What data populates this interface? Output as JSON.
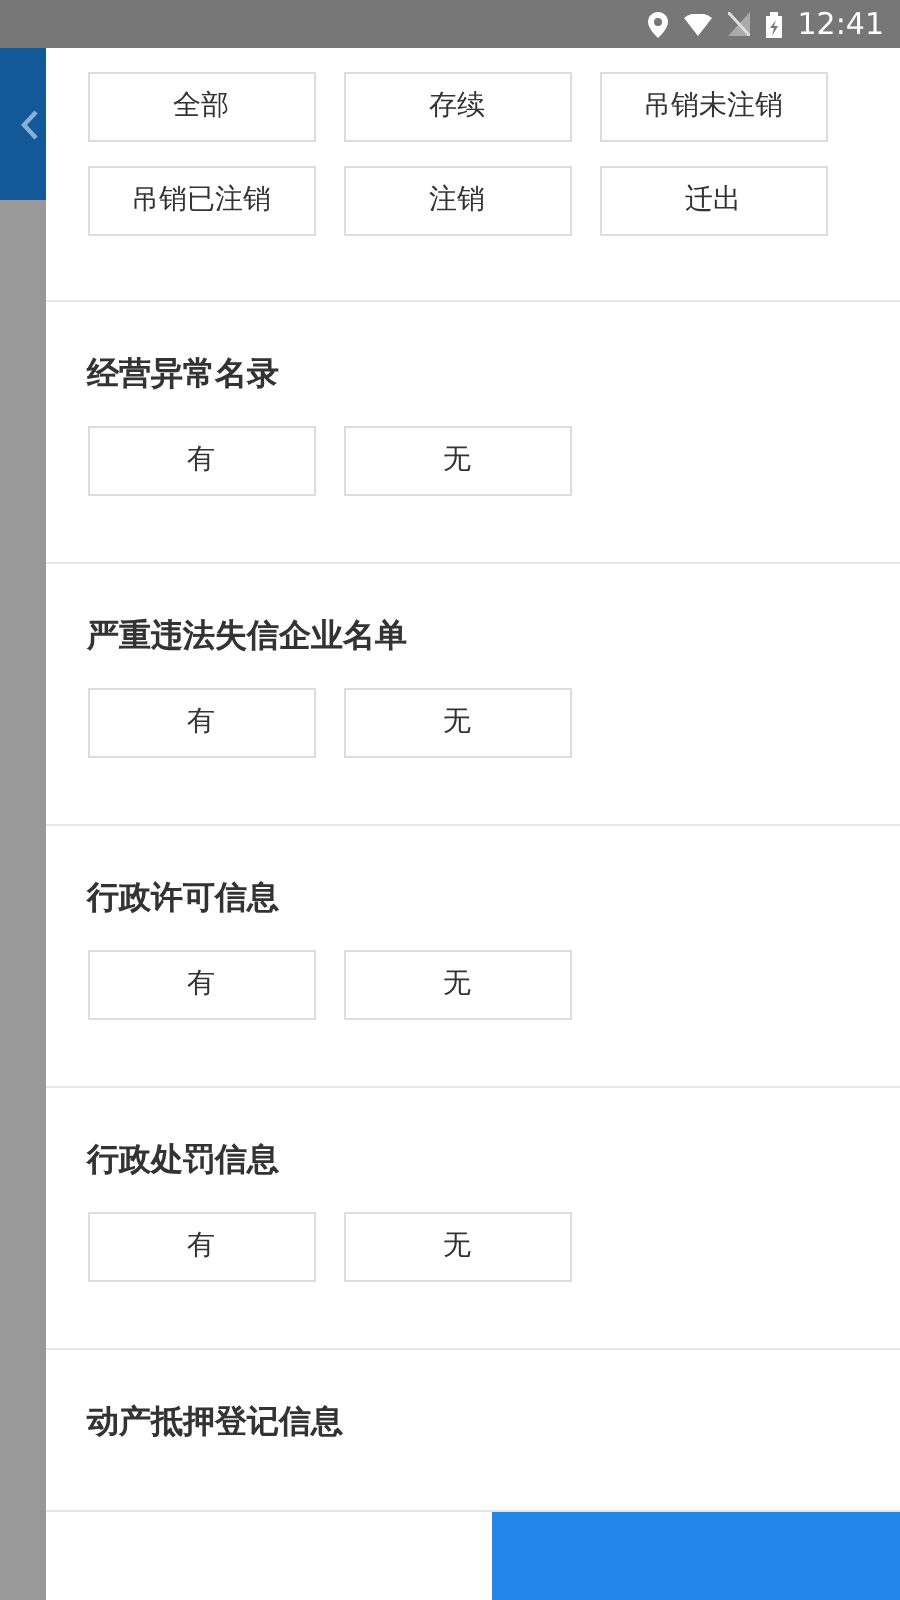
{
  "status_bar": {
    "time": "12:41"
  },
  "status_filter": {
    "options": [
      {
        "label": "全部",
        "selected": false
      },
      {
        "label": "存续",
        "selected": false
      },
      {
        "label": "吊销未注销",
        "selected": false
      },
      {
        "label": "吊销已注销",
        "selected": false
      },
      {
        "label": "注销",
        "selected": false
      },
      {
        "label": "迁出",
        "selected": false
      }
    ]
  },
  "sections": [
    {
      "title": "经营异常名录",
      "options": [
        {
          "label": "有",
          "selected": false
        },
        {
          "label": "无",
          "selected": false
        }
      ]
    },
    {
      "title": "严重违法失信企业名单",
      "options": [
        {
          "label": "有",
          "selected": false
        },
        {
          "label": "无",
          "selected": false
        }
      ]
    },
    {
      "title": "行政许可信息",
      "options": [
        {
          "label": "有",
          "selected": false
        },
        {
          "label": "无",
          "selected": false
        }
      ]
    },
    {
      "title": "行政处罚信息",
      "options": [
        {
          "label": "有",
          "selected": false
        },
        {
          "label": "无",
          "selected": false
        }
      ]
    },
    {
      "title": "动产抵押登记信息"
    }
  ]
}
